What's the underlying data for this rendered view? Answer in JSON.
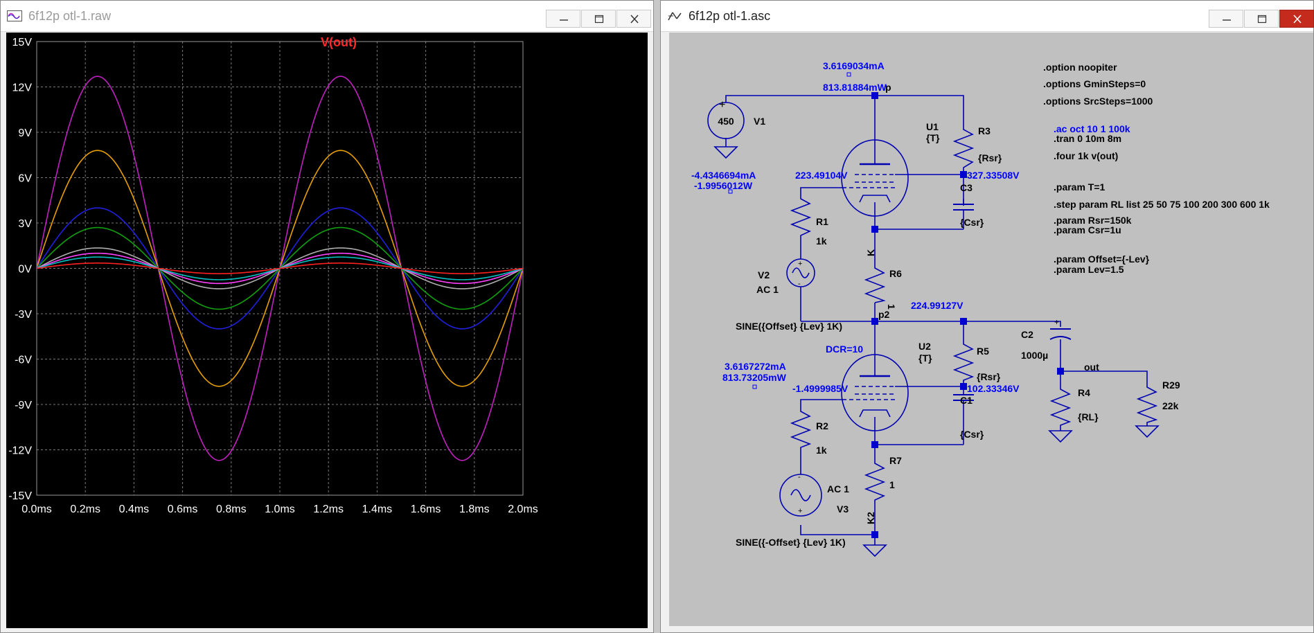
{
  "plot_window": {
    "title": "6f12p otl-1.raw",
    "trace_label": "V(out)",
    "colors": {
      "background": "#000000",
      "grid": "#7a7a7a",
      "axis_text": "#ffffff",
      "trace_label": "#ff2a2a"
    }
  },
  "schematic_window": {
    "title": "6f12p otl-1.asc",
    "colors": {
      "background": "#c0c0c0",
      "wire": "#0000b0",
      "text": "#000000",
      "annotation": "#0000ff"
    },
    "labels": {
      "top_current": "3.6169034mA",
      "top_power": "813.81884mW",
      "node_p": "p",
      "v1_value": "450",
      "v1_name": "V1",
      "v1_current": "-4.4346694mA",
      "v1_power": "-1.9956012W",
      "u1_grid_v": "223.49104V",
      "u1_name": "U1",
      "u1_model": "{T}",
      "r3_name": "R3",
      "r3_value": "{Rsr}",
      "u1_screen_v": "327.33508V",
      "c3_name": "C3",
      "c3_value": "{Csr}",
      "r1_name": "R1",
      "r1_value": "1k",
      "node_k": "K",
      "v2_name": "V2",
      "v2_ac": "AC 1",
      "r6_name": "R6",
      "r6_value": "1",
      "node_p2": "p2",
      "p2_voltage": "224.99127V",
      "v2_sine": "SINE({Offset} {Lev} 1K)",
      "c2_name": "C2",
      "c2_value": "1000µ",
      "dcr": "DCR=10",
      "u2_name": "U2",
      "u2_model": "{T}",
      "r5_name": "R5",
      "r5_value": "{Rsr}",
      "u2_current": "3.6167272mA",
      "u2_power": "813.73205mW",
      "u2_grid_v": "-1.4999985V",
      "u2_screen_v": "102.33346V",
      "node_out": "out",
      "r4_name": "R4",
      "r4_value": "{RL}",
      "r29_name": "R29",
      "r29_value": "22k",
      "c1_name": "C1",
      "c1_value": "{Csr}",
      "r2_name": "R2",
      "r2_value": "1k",
      "r7_name": "R7",
      "r7_value": "1",
      "v3_ac": "AC 1",
      "v3_name": "V3",
      "node_k2": "K2",
      "v3_sine": "SINE({-Offset} {Lev} 1K)"
    },
    "directives": {
      "opt1": ".option noopiter",
      "opt2": ".options GminSteps=0",
      "opt3": ".options SrcSteps=1000",
      "ac": ".ac oct 10 1 100k",
      "tran": ".tran 0 10m 8m",
      "four": ".four 1k v(out)",
      "param_t": ".param T=1",
      "step": ".step param RL list 25 50 75 100 200 300 600 1k",
      "param_rsr": ".param Rsr=150k",
      "param_csr": ".param Csr=1u",
      "param_offset": ".param Offset={-Lev}",
      "param_lev": ".param Lev=1.5"
    }
  },
  "chart_data": {
    "type": "line",
    "title": "V(out)",
    "xlabel": "",
    "ylabel": "",
    "xlim": [
      0,
      2.0
    ],
    "ylim": [
      -15,
      15
    ],
    "x_ticks": [
      "0.0ms",
      "0.2ms",
      "0.4ms",
      "0.6ms",
      "0.8ms",
      "1.0ms",
      "1.2ms",
      "1.4ms",
      "1.6ms",
      "1.8ms",
      "2.0ms"
    ],
    "y_ticks": [
      "15V",
      "12V",
      "9V",
      "6V",
      "3V",
      "0V",
      "-3V",
      "-6V",
      "-9V",
      "-12V",
      "-15V"
    ],
    "grid": true,
    "waveform": "sine, 1 kHz, phase 0",
    "series": [
      {
        "amplitude_v": 12.7,
        "color": "#c020c0"
      },
      {
        "amplitude_v": 7.8,
        "color": "#e8a000"
      },
      {
        "amplitude_v": 4.0,
        "color": "#2020e0"
      },
      {
        "amplitude_v": 2.7,
        "color": "#10a010"
      },
      {
        "amplitude_v": 1.35,
        "color": "#b0b0b0"
      },
      {
        "amplitude_v": 1.0,
        "color": "#ff40ff"
      },
      {
        "amplitude_v": 0.75,
        "color": "#00c0c0"
      },
      {
        "amplitude_v": 0.35,
        "color": "#ff2020"
      }
    ]
  }
}
